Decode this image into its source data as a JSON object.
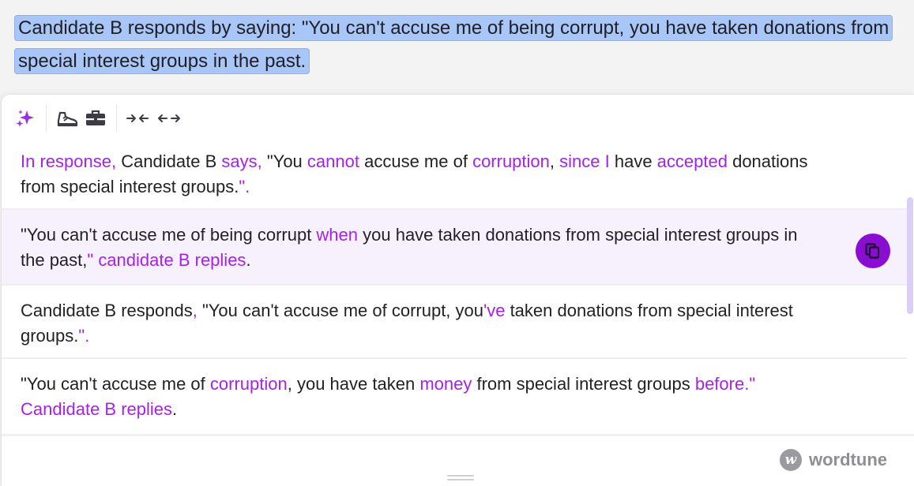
{
  "source_text": "Candidate B responds by saying: \"You can't accuse me of being corrupt, you have taken donations from special interest groups in the past.",
  "toolbar": {
    "buttons": [
      {
        "name": "rewrite",
        "icon": "sparkles-icon"
      },
      {
        "name": "casual",
        "icon": "sneaker-icon"
      },
      {
        "name": "formal",
        "icon": "briefcase-icon"
      },
      {
        "name": "shorten",
        "icon": "shorten-arrows-icon"
      },
      {
        "name": "expand",
        "icon": "expand-arrows-icon"
      }
    ]
  },
  "suggestions": [
    {
      "parts": [
        {
          "t": "In response,",
          "h": true
        },
        {
          "t": " Candidate B ",
          "h": false
        },
        {
          "t": "says,",
          "h": true
        },
        {
          "t": " \"You ",
          "h": false
        },
        {
          "t": "cannot",
          "h": true
        },
        {
          "t": " accuse me of ",
          "h": false
        },
        {
          "t": "corruption",
          "h": true
        },
        {
          "t": ", ",
          "h": false
        },
        {
          "t": "since I",
          "h": true
        },
        {
          "t": " have ",
          "h": false
        },
        {
          "t": "accepted",
          "h": true
        },
        {
          "t": " donations from special interest groups.",
          "h": false
        },
        {
          "t": "\".",
          "h": true
        }
      ]
    },
    {
      "parts": [
        {
          "t": "\"You can't accuse me of being corrupt ",
          "h": false
        },
        {
          "t": "when",
          "h": true
        },
        {
          "t": " you have taken donations from special interest groups in the past,",
          "h": false
        },
        {
          "t": "\" candidate B replies",
          "h": true
        },
        {
          "t": ".",
          "h": false
        }
      ]
    },
    {
      "parts": [
        {
          "t": "Candidate B responds",
          "h": false
        },
        {
          "t": ",",
          "h": true
        },
        {
          "t": " \"You can't accuse me of corrupt, you",
          "h": false
        },
        {
          "t": "'ve",
          "h": true
        },
        {
          "t": " taken donations from special interest groups.",
          "h": false
        },
        {
          "t": "\".",
          "h": true
        }
      ]
    },
    {
      "parts": [
        {
          "t": "\"You can't accuse me of ",
          "h": false
        },
        {
          "t": "corruption",
          "h": true
        },
        {
          "t": ", you have taken ",
          "h": false
        },
        {
          "t": "money",
          "h": true
        },
        {
          "t": " from special interest groups ",
          "h": false
        },
        {
          "t": "before.\" Candidate B replies",
          "h": true
        },
        {
          "t": ".",
          "h": false
        }
      ]
    }
  ],
  "brand": {
    "name": "wordtune",
    "logo_letter": "w"
  },
  "colors": {
    "accent": "#a522e6",
    "copy_button": "#8a0ed1",
    "selection": "#a9c6f8",
    "hovered_row": "#f6f1fd",
    "scrollbar": "#dccff6"
  }
}
